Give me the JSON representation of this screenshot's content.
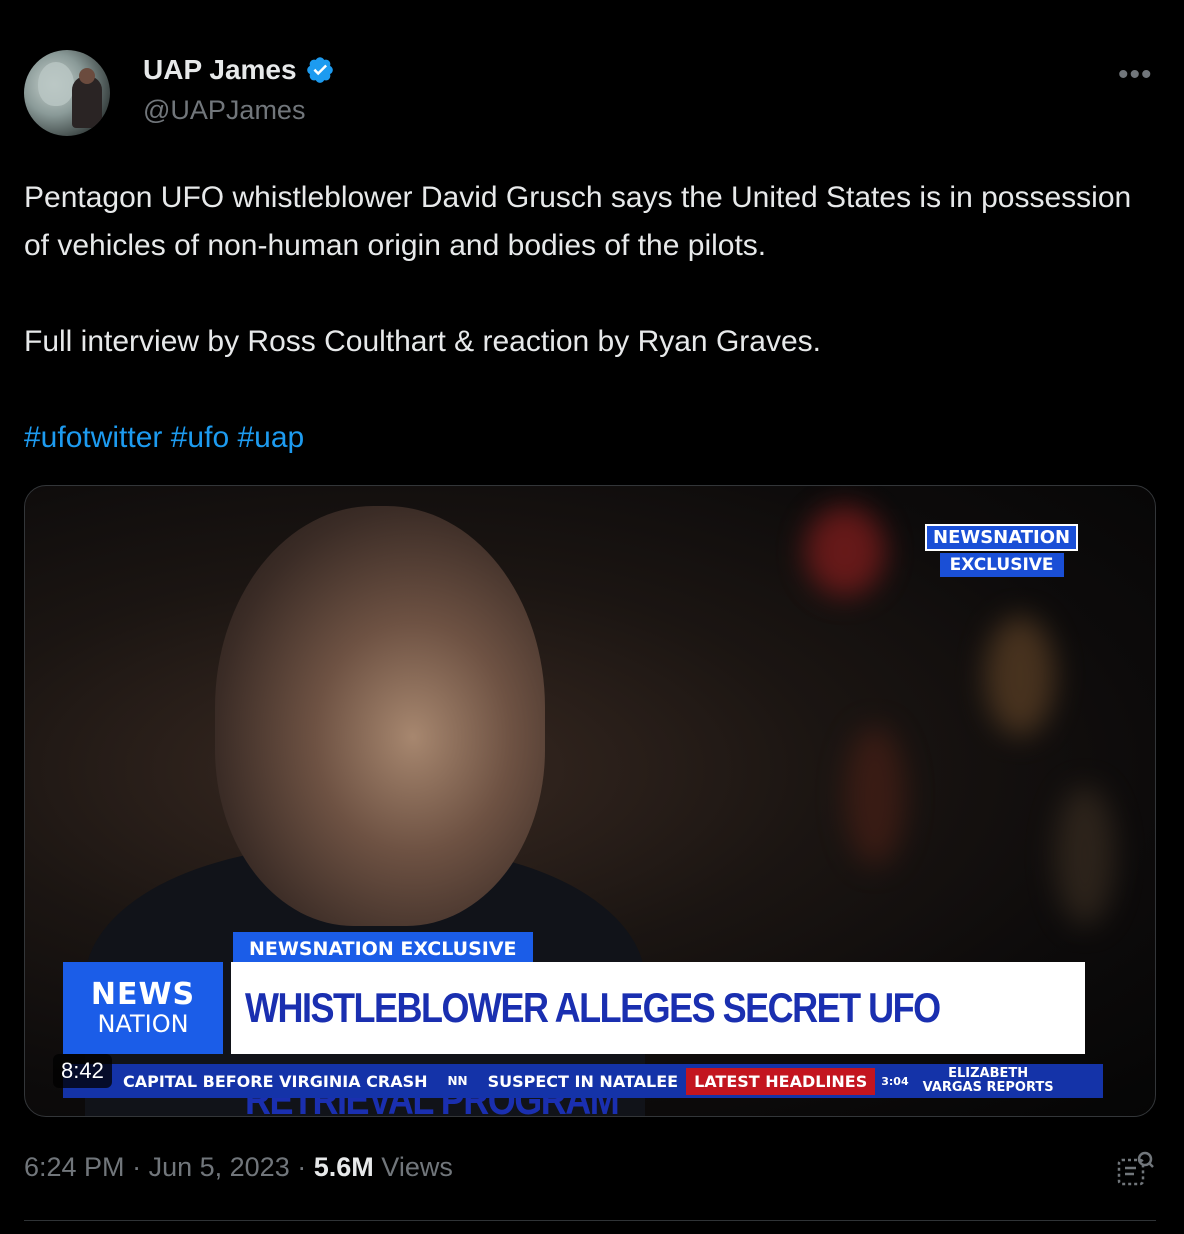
{
  "author": {
    "name": "UAP James",
    "handle": "@UAPJames",
    "verified": true,
    "avatar_icon": "avatar-alien-photo"
  },
  "more_icon": "ellipsis-icon",
  "tweet": {
    "paragraph1": "Pentagon UFO whistleblower David Grusch says the United States is in possession of vehicles of non-human origin and bodies of the pilots.",
    "paragraph2": "Full interview by Ross Coulthart & reaction by Ryan Graves.",
    "hashtags": [
      "#ufotwitter",
      "#ufo",
      "#uap"
    ]
  },
  "video": {
    "duration": "8:42",
    "logo_top_line1": "NEWSNATION",
    "logo_top_line2": "EXCLUSIVE",
    "chyron_tag": "NEWSNATION EXCLUSIVE",
    "logo_box_line1": "NEWS",
    "logo_box_line2": "NATION",
    "headline": "WHISTLEBLOWER ALLEGES SECRET UFO RETRIEVAL PROGRAM",
    "ticker": {
      "item1": "CAPITAL BEFORE VIRGINIA CRASH",
      "nn": "NN",
      "item2": "SUSPECT IN NATALEE",
      "latest": "LATEST HEADLINES",
      "clock": "3:04",
      "vargas_line1": "ELIZABETH",
      "vargas_line2": "VARGAS REPORTS"
    }
  },
  "meta": {
    "time": "6:24 PM",
    "sep": "·",
    "date": "Jun 5, 2023",
    "views_count": "5.6M",
    "views_label": "Views"
  },
  "colors": {
    "background": "#000000",
    "text": "#e7e9ea",
    "secondary": "#71767b",
    "link": "#1d9bf0",
    "verified": "#1d9bf0"
  }
}
